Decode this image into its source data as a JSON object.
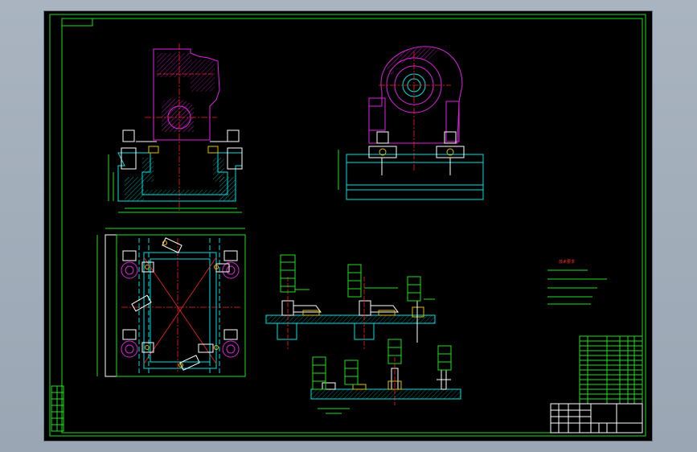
{
  "drawing": {
    "notes_title": "技术要求",
    "colors": {
      "background": "#000000",
      "border": "#20e020",
      "outline": "#00e0e0",
      "part": "#e020e0",
      "centerline": "#ff2020",
      "fastener": "#ffffff",
      "accent": "#e0c000"
    }
  }
}
